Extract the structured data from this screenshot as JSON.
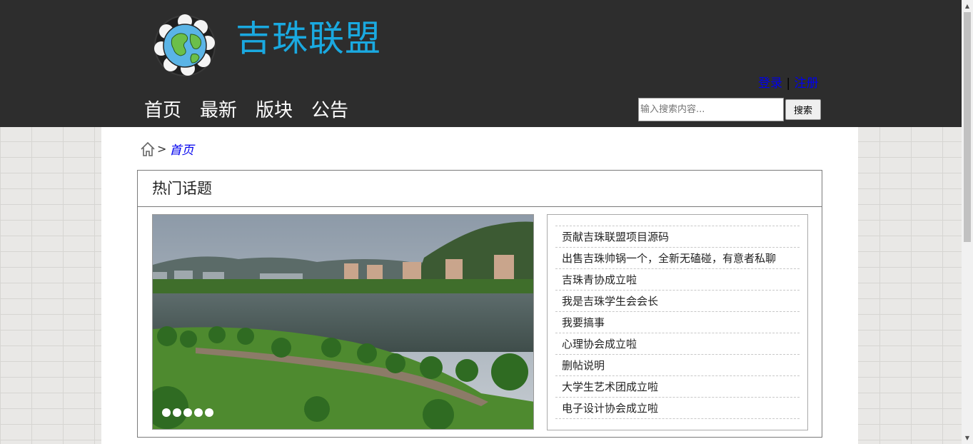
{
  "header": {
    "site_title": "吉珠联盟",
    "auth": {
      "login": "登录",
      "separator": "|",
      "register": "注册"
    },
    "nav": [
      "首页",
      "最新",
      "版块",
      "公告"
    ],
    "search": {
      "placeholder": "输入搜索内容...",
      "button": "搜索"
    }
  },
  "breadcrumb": {
    "separator": ">",
    "current": "首页"
  },
  "hot_topics": {
    "title": "热门话题",
    "slider_dot_count": 5,
    "topics": [
      "贡献吉珠联盟项目源码",
      "出售吉珠帅锅一个，全新无磕碰，有意者私聊",
      "吉珠青协成立啦",
      "我是吉珠学生会会长",
      "我要搞事",
      "心理协会成立啦",
      "删帖说明",
      "大学生艺术团成立啦",
      "电子设计协会成立啦"
    ]
  },
  "colors": {
    "header_bg": "#2d2d2d",
    "title": "#1aa9e0",
    "link": "#0000ee"
  }
}
